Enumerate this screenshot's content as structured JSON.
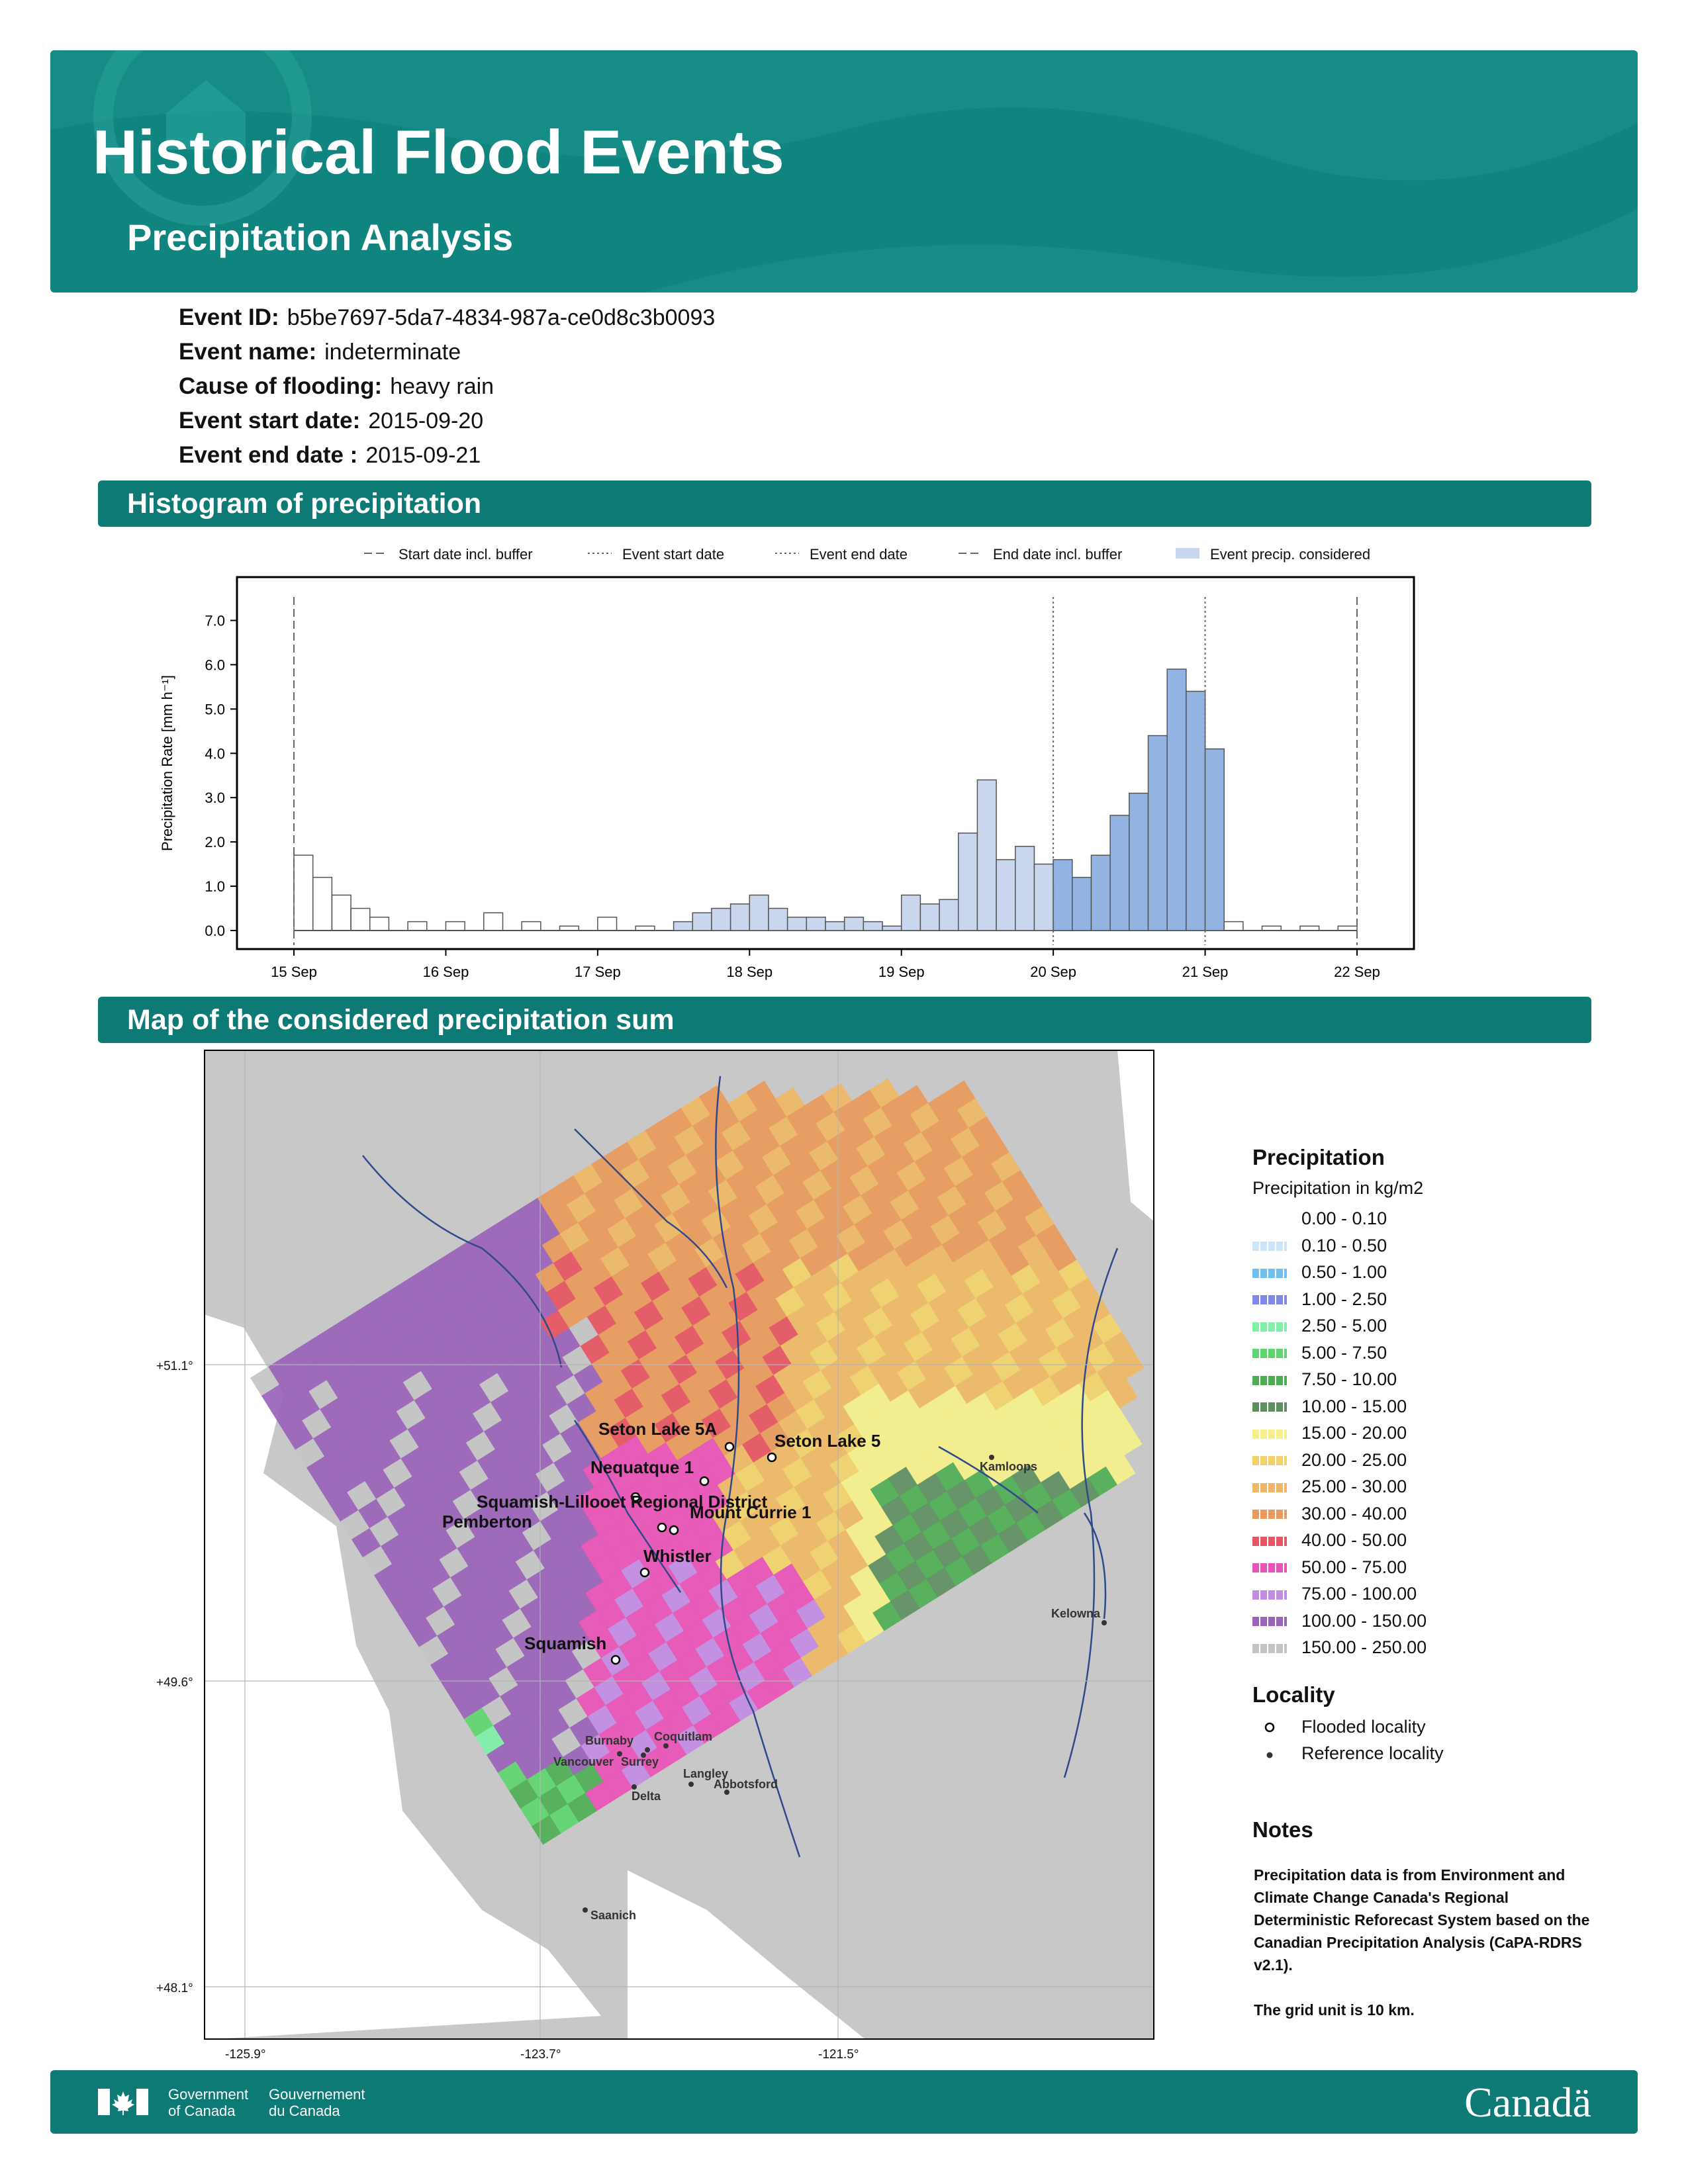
{
  "header": {
    "title": "Historical Flood Events",
    "subtitle": "Precipitation Analysis"
  },
  "event": {
    "id_label": "Event ID:",
    "id": "b5be7697-5da7-4834-987a-ce0d8c3b0093",
    "name_label": "Event name:",
    "name": "indeterminate",
    "cause_label": "Cause of flooding:",
    "cause": "heavy rain",
    "start_label": "Event start date:",
    "start": "2015-09-20",
    "end_label": "Event end date :",
    "end": "2015-09-21"
  },
  "sections": {
    "histogram": "Histogram of precipitation",
    "map": "Map of the considered precipitation sum"
  },
  "chart_data": {
    "type": "bar",
    "title": "",
    "xlabel": "",
    "ylabel": "Precipitation Rate [mm h⁻¹]",
    "ylim": [
      0,
      7.5
    ],
    "yticks": [
      "0.0",
      "1.0",
      "2.0",
      "3.0",
      "4.0",
      "5.0",
      "6.0",
      "7.0"
    ],
    "xticks": [
      "15 Sep",
      "16 Sep",
      "17 Sep",
      "18 Sep",
      "19 Sep",
      "20 Sep",
      "21 Sep",
      "22 Sep"
    ],
    "legend": [
      "Start date incl. buffer",
      "Event start date",
      "Event end date",
      "End date incl. buffer",
      "Event precip. considered"
    ],
    "legend_position": "top",
    "markers": {
      "start_incl_buffer": "2015-09-15",
      "event_start": "2015-09-20",
      "event_end": "2015-09-21",
      "end_incl_buffer": "2015-09-22"
    },
    "colors": {
      "considered": "#c9d6ee",
      "considered_dark": "#93b3e2",
      "outline": "#555555"
    },
    "series": [
      {
        "name": "Event precip. considered",
        "x": [
          "2015-09-17T12:00",
          "2015-09-17T15:00",
          "2015-09-17T18:00",
          "2015-09-17T21:00",
          "2015-09-18T00:00",
          "2015-09-18T03:00",
          "2015-09-18T06:00",
          "2015-09-18T09:00",
          "2015-09-18T12:00",
          "2015-09-18T15:00",
          "2015-09-18T18:00",
          "2015-09-18T21:00",
          "2015-09-19T00:00",
          "2015-09-19T03:00",
          "2015-09-19T06:00",
          "2015-09-19T09:00",
          "2015-09-19T12:00",
          "2015-09-19T15:00",
          "2015-09-19T18:00",
          "2015-09-19T21:00",
          "2015-09-20T00:00",
          "2015-09-20T03:00",
          "2015-09-20T06:00",
          "2015-09-20T09:00",
          "2015-09-20T12:00",
          "2015-09-20T15:00",
          "2015-09-20T18:00",
          "2015-09-20T21:00",
          "2015-09-21T00:00"
        ],
        "values": [
          0.2,
          0.4,
          0.5,
          0.6,
          0.8,
          0.5,
          0.3,
          0.3,
          0.2,
          0.3,
          0.2,
          0.1,
          0.8,
          0.6,
          0.7,
          2.2,
          3.4,
          1.6,
          1.9,
          1.5,
          1.6,
          1.2,
          1.7,
          2.6,
          3.1,
          4.4,
          5.9,
          5.4,
          4.1
        ]
      },
      {
        "name": "",
        "x": [
          "2015-09-15T00:00",
          "2015-09-15T03:00",
          "2015-09-15T06:00",
          "2015-09-15T09:00",
          "2015-09-15T12:00",
          "2015-09-15T18:00",
          "2015-09-16T00:00",
          "2015-09-16T06:00",
          "2015-09-16T12:00",
          "2015-09-16T18:00",
          "2015-09-17T00:00",
          "2015-09-17T06:00",
          "2015-09-21T03:00",
          "2015-09-21T09:00",
          "2015-09-21T15:00",
          "2015-09-21T21:00"
        ],
        "values": [
          1.7,
          1.2,
          0.8,
          0.5,
          0.3,
          0.2,
          0.2,
          0.4,
          0.2,
          0.1,
          0.3,
          0.1,
          0.2,
          0.1,
          0.1,
          0.1
        ]
      }
    ]
  },
  "map": {
    "lon_ticks": [
      "-125.9°",
      "-123.7°",
      "-121.5°"
    ],
    "lat_ticks": [
      "+51.1°",
      "+49.6°",
      "+48.1°"
    ],
    "flooded_localities": [
      "Seton Lake 5A",
      "Seton Lake 5",
      "Nequatque 1",
      "Squamish-Lillooet Regional District",
      "Pemberton",
      "Mount Currie 1",
      "Whistler",
      "Squamish"
    ],
    "reference_localities": [
      "Kamloops",
      "Kelowna",
      "Burnaby",
      "Coquitlam",
      "Vancouver",
      "Surrey",
      "Langley",
      "Abbotsford",
      "Delta",
      "Saanich"
    ]
  },
  "legend": {
    "title": "Precipitation",
    "subtitle": "Precipitation in kg/m2",
    "classes": [
      {
        "label": "0.00 - 0.10",
        "color": "#ffffff"
      },
      {
        "label": "0.10 - 0.50",
        "color": "#cde6f7"
      },
      {
        "label": "0.50 - 1.00",
        "color": "#6fc0ee"
      },
      {
        "label": "1.00 - 2.50",
        "color": "#8087e8"
      },
      {
        "label": "2.50 - 5.00",
        "color": "#7ef0a8"
      },
      {
        "label": "5.00 - 7.50",
        "color": "#5ed66f"
      },
      {
        "label": "7.50 - 10.00",
        "color": "#4fae55"
      },
      {
        "label": "10.00 - 15.00",
        "color": "#5e8f60"
      },
      {
        "label": "15.00 - 20.00",
        "color": "#f5f08a"
      },
      {
        "label": "20.00 - 25.00",
        "color": "#f2d36a"
      },
      {
        "label": "25.00 - 30.00",
        "color": "#efb865"
      },
      {
        "label": "30.00 - 40.00",
        "color": "#e99a5c"
      },
      {
        "label": "40.00 - 50.00",
        "color": "#e65562"
      },
      {
        "label": "50.00 - 75.00",
        "color": "#e953b6"
      },
      {
        "label": "75.00 - 100.00",
        "color": "#c38be3"
      },
      {
        "label": "100.00 - 150.00",
        "color": "#9a62b8"
      },
      {
        "label": "150.00 - 250.00",
        "color": "#c4c4c4"
      }
    ],
    "locality_title": "Locality",
    "flooded_label": "Flooded locality",
    "reference_label": "Reference locality"
  },
  "notes": {
    "title": "Notes",
    "text1": "Precipitation data is from Environment and Climate Change Canada's Regional Deterministic Reforecast System based on the Canadian Precipitation Analysis (CaPA-RDRS v2.1).",
    "text2": "The grid unit is 10 km."
  },
  "footer": {
    "gov_en_1": "Government",
    "gov_en_2": "of Canada",
    "gov_fr_1": "Gouvernement",
    "gov_fr_2": "du Canada",
    "wordmark": "Canadä"
  }
}
